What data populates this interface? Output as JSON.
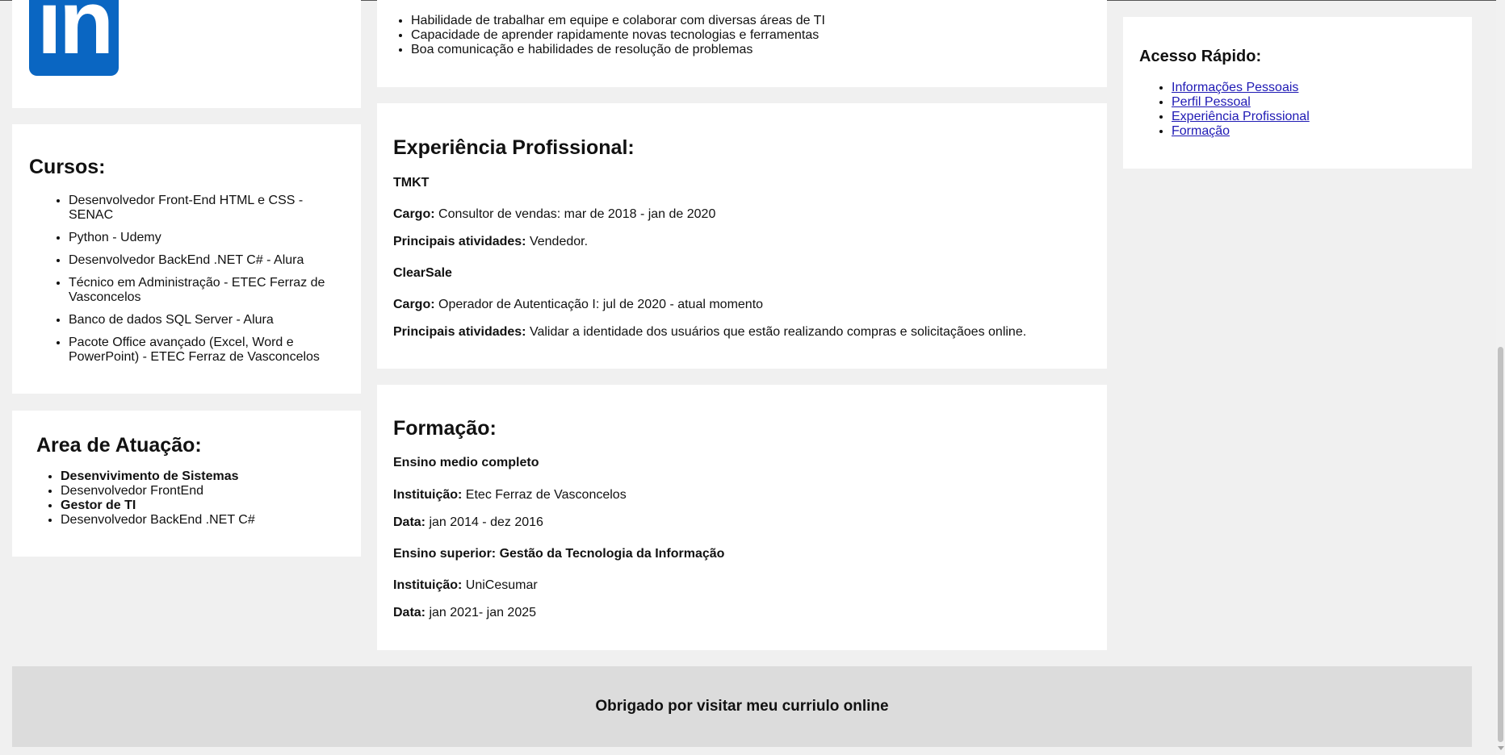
{
  "linkedin": {
    "logo_text": "in"
  },
  "skills": {
    "items": [
      "Habilidade de trabalhar em equipe e colaborar com diversas áreas de TI",
      "Capacidade de aprender rapidamente novas tecnologias e ferramentas",
      "Boa comunicação e habilidades de resolução de problemas"
    ]
  },
  "courses": {
    "title": "Cursos:",
    "items": [
      "Desenvolvedor Front-End HTML e CSS - SENAC",
      "Python - Udemy",
      "Desenvolvedor BackEnd .NET C# - Alura",
      "Técnico em Administração - ETEC Ferraz de Vasconcelos",
      "Banco de dados SQL Server - Alura",
      "Pacote Office avançado (Excel, Word e PowerPoint) - ETEC Ferraz de Vasconcelos"
    ]
  },
  "area": {
    "title": "Area de Atuação:",
    "items": [
      "Desenvivimento de Sistemas",
      "Desenvolvedor FrontEnd",
      "Gestor de TI",
      "Desenvolvedor BackEnd .NET C#"
    ]
  },
  "experience": {
    "title": "Experiência Profissional:",
    "jobs": [
      {
        "company": "TMKT",
        "role_label": "Cargo:",
        "role": "Consultor de vendas: mar de 2018 - jan de 2020",
        "activities_label": "Principais atividades:",
        "activities": "Vendedor."
      },
      {
        "company": "ClearSale",
        "role_label": "Cargo:",
        "role": "Operador de Autenticação I: jul de 2020 - atual momento",
        "activities_label": "Principais atividades:",
        "activities": "Validar a identidade dos usuários que estão realizando compras e solicitaçãoes online."
      }
    ]
  },
  "education": {
    "title": "Formação:",
    "entries": [
      {
        "degree": "Ensino medio completo",
        "institution_label": "Instituição:",
        "institution": "Etec Ferraz de Vasconcelos",
        "date_label": "Data:",
        "date": "jan 2014 - dez 2016"
      },
      {
        "degree": "Ensino superior: Gestão da Tecnologia da Informação",
        "institution_label": "Instituição:",
        "institution": "UniCesumar",
        "date_label": "Data:",
        "date": "jan 2021- jan 2025"
      }
    ]
  },
  "quick_access": {
    "title": "Acesso Rápido:",
    "links": [
      "Informações Pessoais",
      "Perfil Pessoal",
      "Experiência Profissional",
      "Formação"
    ]
  },
  "footer": {
    "text": "Obrigado por visitar meu curriulo online"
  },
  "colors": {
    "background": "#f0f0f0",
    "panel": "#ffffff",
    "footer": "#dcdcdc",
    "linkedin_blue": "#0a66c2",
    "link": "#1a0dab"
  }
}
